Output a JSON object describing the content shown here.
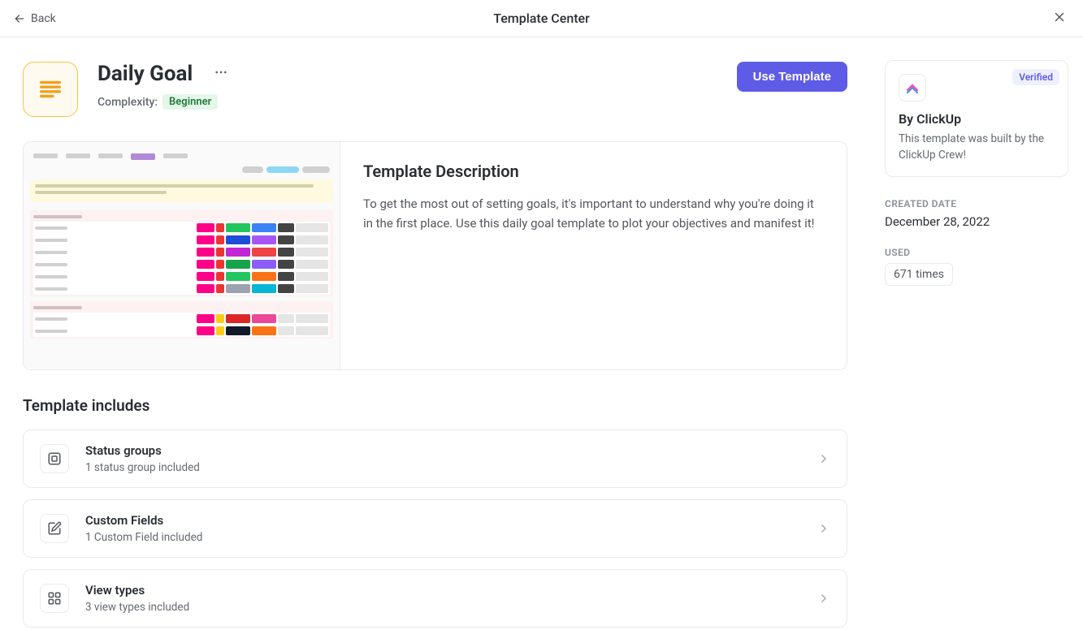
{
  "topbar": {
    "back": "Back",
    "title": "Template Center"
  },
  "template": {
    "title": "Daily Goal",
    "complexity_label": "Complexity:",
    "complexity_value": "Beginner",
    "use_button": "Use Template"
  },
  "description": {
    "heading": "Template Description",
    "body": "To get the most out of setting goals, it's important to understand why you're doing it in the first place. Use this daily goal template to plot your objectives and manifest it!"
  },
  "includes": {
    "heading": "Template includes",
    "items": [
      {
        "title": "Status groups",
        "sub": "1 status group included"
      },
      {
        "title": "Custom Fields",
        "sub": "1 Custom Field included"
      },
      {
        "title": "View types",
        "sub": "3 view types included"
      }
    ]
  },
  "sidebar": {
    "verified": "Verified",
    "author_name": "By ClickUp",
    "author_desc": "This template was built by the ClickUp Crew!",
    "created_label": "CREATED DATE",
    "created_value": "December 28, 2022",
    "used_label": "USED",
    "used_value": "671 times"
  }
}
